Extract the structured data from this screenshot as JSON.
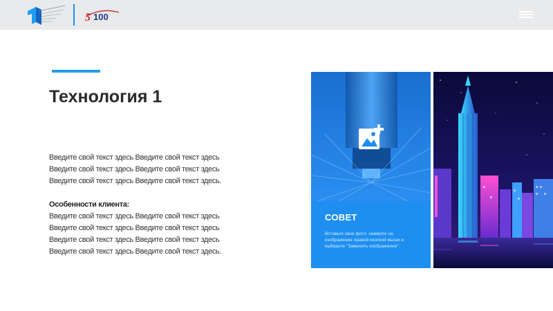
{
  "slide": {
    "title": "Технология 1",
    "body_lines": [
      "Введите свой текст здесь Введите свой текст здесь",
      "Введите свой текст здесь Введите свой текст здесь",
      "Введите свой текст здесь Введите свой текст здесь."
    ],
    "features_heading": "Особенности клиента:",
    "features_lines": [
      "Введите свой текст здесь Введите свой текст здесь",
      "Введите свой текст здесь Введите свой текст здесь",
      "Введите свой текст здесь Введите свой текст здесь",
      "Введите свой текст здесь Введите свой текст здесь."
    ]
  },
  "tip": {
    "title": "СОВЕТ",
    "text": "Вставьте свое фото: нажмите на изображение правой кнопкой мыши и выберите \"Заменить изображение\"."
  },
  "header": {
    "logo_text": "5100",
    "icons": {
      "menu": "hamburger-menu-icon",
      "insert": "insert-photo-icon"
    }
  },
  "colors": {
    "accent": "#1e9cf0",
    "tip_background": "#1e8ff0",
    "topbar": "#e8eaec",
    "logo_red": "#c8262d",
    "logo_navy": "#1f3a8a"
  }
}
